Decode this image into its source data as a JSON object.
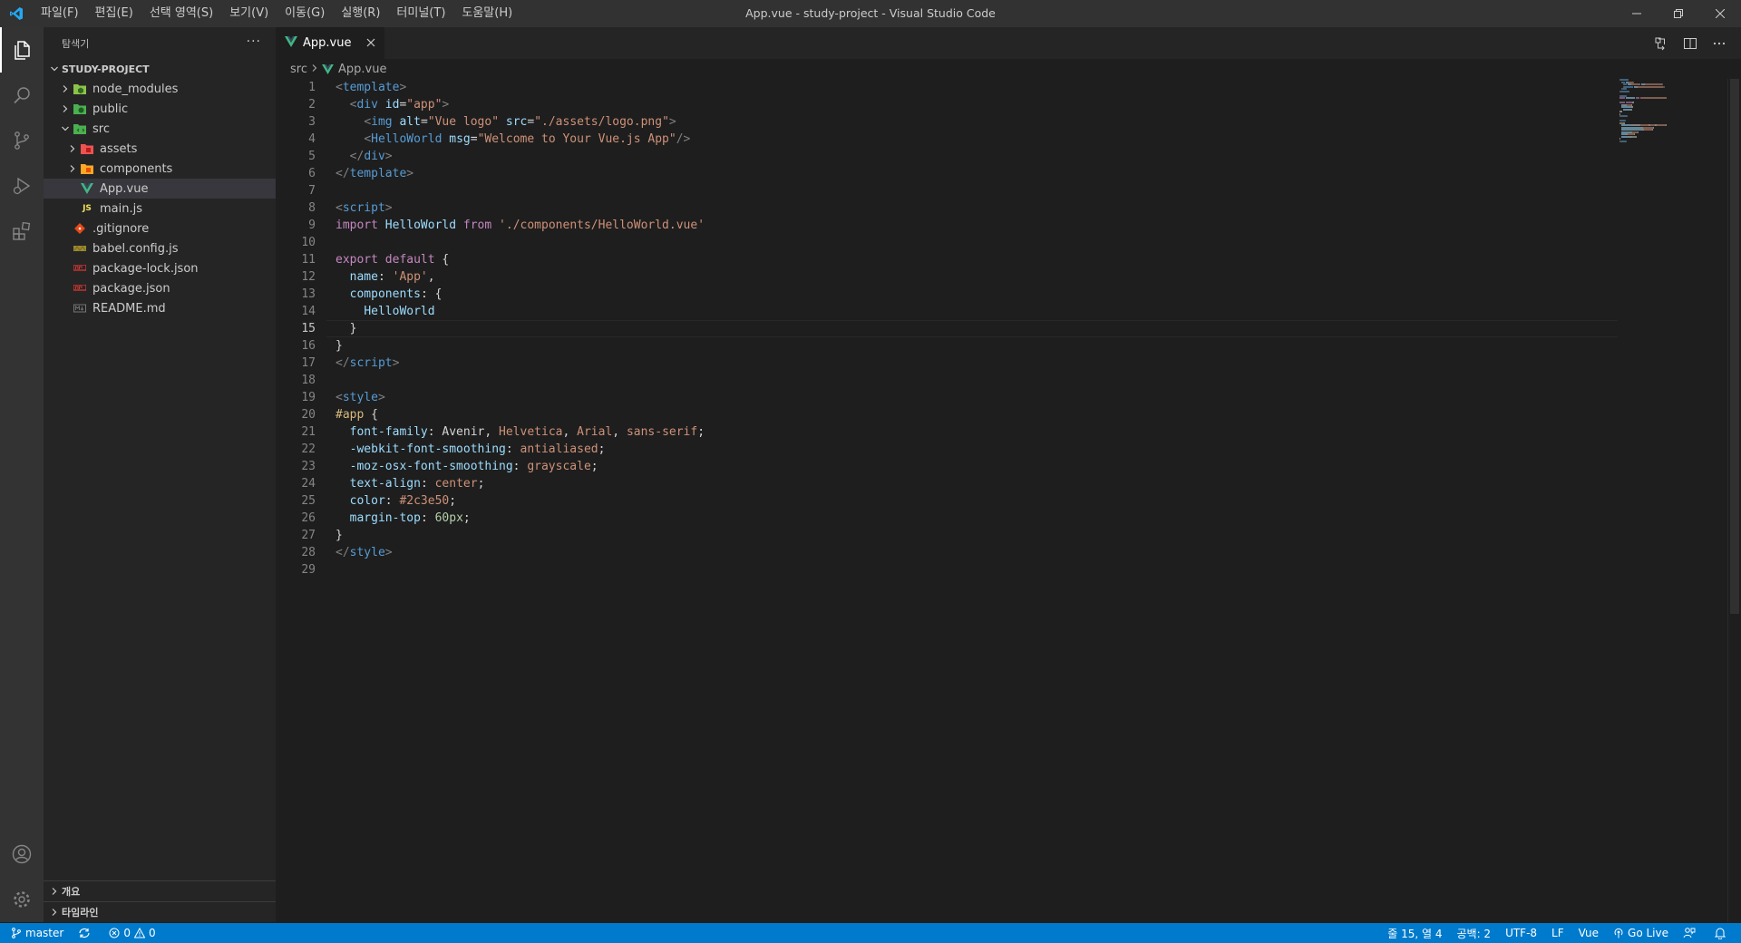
{
  "window": {
    "title": "App.vue - study-project - Visual Studio Code",
    "menu": [
      "파일(F)",
      "편집(E)",
      "선택 영역(S)",
      "보기(V)",
      "이동(G)",
      "실행(R)",
      "터미널(T)",
      "도움말(H)"
    ]
  },
  "sidebar": {
    "title": "탐색기",
    "more": "···",
    "project": "STUDY-PROJECT",
    "tree": [
      {
        "label": "node_modules",
        "icon": "folder-node-icon",
        "depth": 1,
        "chevron": "›"
      },
      {
        "label": "public",
        "icon": "folder-public-icon",
        "depth": 1,
        "chevron": "›"
      },
      {
        "label": "src",
        "icon": "folder-src-icon",
        "depth": 1,
        "chevron": "⌄"
      },
      {
        "label": "assets",
        "icon": "folder-assets-icon",
        "depth": 2,
        "chevron": "›"
      },
      {
        "label": "components",
        "icon": "folder-components-icon",
        "depth": 2,
        "chevron": "›"
      },
      {
        "label": "App.vue",
        "icon": "vue-file-icon",
        "depth": 2,
        "selected": true
      },
      {
        "label": "main.js",
        "icon": "js-file-icon",
        "depth": 2
      },
      {
        "label": ".gitignore",
        "icon": "git-file-icon",
        "depth": 1
      },
      {
        "label": "babel.config.js",
        "icon": "babel-file-icon",
        "depth": 1
      },
      {
        "label": "package-lock.json",
        "icon": "npm-file-icon",
        "depth": 1
      },
      {
        "label": "package.json",
        "icon": "npm-file-icon",
        "depth": 1
      },
      {
        "label": "README.md",
        "icon": "markdown-file-icon",
        "depth": 1
      }
    ],
    "outline": "개요",
    "timeline": "타임라인"
  },
  "editor": {
    "tab_label": "App.vue",
    "breadcrumb": [
      "src",
      "App.vue"
    ],
    "current_line": 15,
    "lines": [
      [
        [
          "t-tag",
          "<"
        ],
        [
          "t-name",
          "template"
        ],
        [
          "t-tag",
          ">"
        ]
      ],
      [
        [
          "t-plain",
          "  "
        ],
        [
          "t-tag",
          "<"
        ],
        [
          "t-name",
          "div"
        ],
        [
          "t-plain",
          " "
        ],
        [
          "t-attr",
          "id"
        ],
        [
          "t-plain",
          "="
        ],
        [
          "t-str",
          "\"app\""
        ],
        [
          "t-tag",
          ">"
        ]
      ],
      [
        [
          "t-plain",
          "    "
        ],
        [
          "t-tag",
          "<"
        ],
        [
          "t-name",
          "img"
        ],
        [
          "t-plain",
          " "
        ],
        [
          "t-attr",
          "alt"
        ],
        [
          "t-plain",
          "="
        ],
        [
          "t-str",
          "\"Vue logo\""
        ],
        [
          "t-plain",
          " "
        ],
        [
          "t-attr",
          "src"
        ],
        [
          "t-plain",
          "="
        ],
        [
          "t-str",
          "\"./assets/logo.png\""
        ],
        [
          "t-tag",
          ">"
        ]
      ],
      [
        [
          "t-plain",
          "    "
        ],
        [
          "t-tag",
          "<"
        ],
        [
          "t-name",
          "HelloWorld"
        ],
        [
          "t-plain",
          " "
        ],
        [
          "t-attr",
          "msg"
        ],
        [
          "t-plain",
          "="
        ],
        [
          "t-str",
          "\"Welcome to Your Vue.js App\""
        ],
        [
          "t-tag",
          "/>"
        ]
      ],
      [
        [
          "t-plain",
          "  "
        ],
        [
          "t-tag",
          "</"
        ],
        [
          "t-name",
          "div"
        ],
        [
          "t-tag",
          ">"
        ]
      ],
      [
        [
          "t-tag",
          "</"
        ],
        [
          "t-name",
          "template"
        ],
        [
          "t-tag",
          ">"
        ]
      ],
      [],
      [
        [
          "t-tag",
          "<"
        ],
        [
          "t-name",
          "script"
        ],
        [
          "t-tag",
          ">"
        ]
      ],
      [
        [
          "t-kw",
          "import"
        ],
        [
          "t-plain",
          " "
        ],
        [
          "t-id",
          "HelloWorld"
        ],
        [
          "t-plain",
          " "
        ],
        [
          "t-kw",
          "from"
        ],
        [
          "t-plain",
          " "
        ],
        [
          "t-str",
          "'./components/HelloWorld.vue'"
        ]
      ],
      [],
      [
        [
          "t-kw",
          "export"
        ],
        [
          "t-plain",
          " "
        ],
        [
          "t-kw",
          "default"
        ],
        [
          "t-plain",
          " {"
        ]
      ],
      [
        [
          "t-plain",
          "  "
        ],
        [
          "t-id",
          "name"
        ],
        [
          "t-plain",
          ": "
        ],
        [
          "t-str",
          "'App'"
        ],
        [
          "t-plain",
          ","
        ]
      ],
      [
        [
          "t-plain",
          "  "
        ],
        [
          "t-id",
          "components"
        ],
        [
          "t-plain",
          ": {"
        ]
      ],
      [
        [
          "t-plain",
          "    "
        ],
        [
          "t-id",
          "HelloWorld"
        ]
      ],
      [
        [
          "t-plain",
          "  }"
        ]
      ],
      [
        [
          "t-plain",
          "}"
        ]
      ],
      [
        [
          "t-tag",
          "</"
        ],
        [
          "t-name",
          "script"
        ],
        [
          "t-tag",
          ">"
        ]
      ],
      [],
      [
        [
          "t-tag",
          "<"
        ],
        [
          "t-name",
          "style"
        ],
        [
          "t-tag",
          ">"
        ]
      ],
      [
        [
          "t-sel",
          "#app"
        ],
        [
          "t-plain",
          " {"
        ]
      ],
      [
        [
          "t-plain",
          "  "
        ],
        [
          "t-attr",
          "font-family"
        ],
        [
          "t-plain",
          ": Avenir, "
        ],
        [
          "t-str",
          "Helvetica"
        ],
        [
          "t-plain",
          ", "
        ],
        [
          "t-str",
          "Arial"
        ],
        [
          "t-plain",
          ", "
        ],
        [
          "t-str",
          "sans-serif"
        ],
        [
          "t-plain",
          ";"
        ]
      ],
      [
        [
          "t-plain",
          "  "
        ],
        [
          "t-attr",
          "-webkit-font-smoothing"
        ],
        [
          "t-plain",
          ": "
        ],
        [
          "t-str",
          "antialiased"
        ],
        [
          "t-plain",
          ";"
        ]
      ],
      [
        [
          "t-plain",
          "  "
        ],
        [
          "t-attr",
          "-moz-osx-font-smoothing"
        ],
        [
          "t-plain",
          ": "
        ],
        [
          "t-str",
          "grayscale"
        ],
        [
          "t-plain",
          ";"
        ]
      ],
      [
        [
          "t-plain",
          "  "
        ],
        [
          "t-attr",
          "text-align"
        ],
        [
          "t-plain",
          ": "
        ],
        [
          "t-str",
          "center"
        ],
        [
          "t-plain",
          ";"
        ]
      ],
      [
        [
          "t-plain",
          "  "
        ],
        [
          "t-attr",
          "color"
        ],
        [
          "t-plain",
          ": "
        ],
        [
          "t-str",
          "#2c3e50"
        ],
        [
          "t-plain",
          ";"
        ]
      ],
      [
        [
          "t-plain",
          "  "
        ],
        [
          "t-attr",
          "margin-top"
        ],
        [
          "t-plain",
          ": "
        ],
        [
          "t-num",
          "60px"
        ],
        [
          "t-plain",
          ";"
        ]
      ],
      [
        [
          "t-plain",
          "}"
        ]
      ],
      [
        [
          "t-tag",
          "</"
        ],
        [
          "t-name",
          "style"
        ],
        [
          "t-tag",
          ">"
        ]
      ],
      []
    ]
  },
  "statusbar": {
    "branch": "master",
    "errors": "0",
    "warnings": "0",
    "position": "줄 15, 열 4",
    "spaces": "공백: 2",
    "encoding": "UTF-8",
    "eol": "LF",
    "language": "Vue",
    "golive": "Go Live"
  },
  "colors": {
    "accent": "#007acc",
    "vue": "#41b883"
  }
}
